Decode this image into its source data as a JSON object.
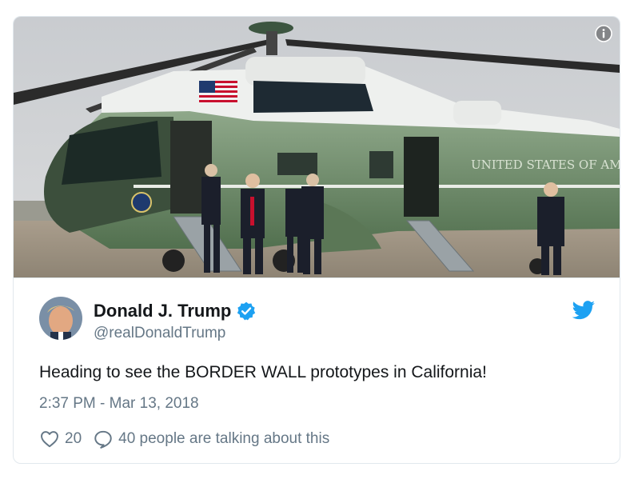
{
  "media": {
    "info_icon": "info-icon",
    "aircraft_marking": "UNITED STATES OF AME"
  },
  "author": {
    "name": "Donald J. Trump",
    "handle": "@realDonaldTrump",
    "verified": true,
    "avatar_icon": "avatar-photo"
  },
  "platform_icon": "twitter-bird-icon",
  "tweet": {
    "text": "Heading to see the BORDER WALL prototypes in California!",
    "timestamp": "2:37 PM - Mar 13, 2018"
  },
  "actions": {
    "like_count": "20",
    "conversation_label": "40 people are talking about this"
  },
  "colors": {
    "twitter_blue": "#1da1f2",
    "muted_text": "#657786",
    "border": "#e1e8ed",
    "helicopter_green": "#6f8b6a"
  }
}
